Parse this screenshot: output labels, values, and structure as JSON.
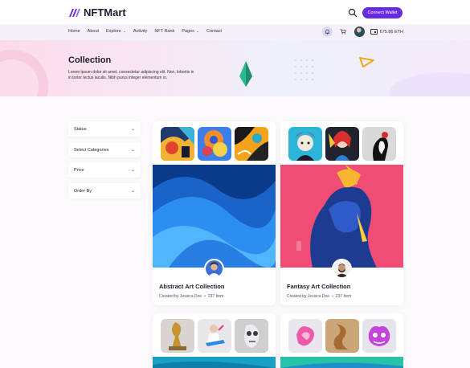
{
  "brand": {
    "name": "NFTMart",
    "accent": "#6a2ae0"
  },
  "header": {
    "connect_label": "Connect Wallet",
    "search_icon": "search-icon"
  },
  "nav": {
    "items": [
      {
        "label": "Home",
        "dropdown": false
      },
      {
        "label": "About",
        "dropdown": false
      },
      {
        "label": "Explore",
        "dropdown": true
      },
      {
        "label": "Activity",
        "dropdown": false
      },
      {
        "label": "NFT Rank",
        "dropdown": false
      },
      {
        "label": "Pages",
        "dropdown": true
      },
      {
        "label": "Contact",
        "dropdown": false
      }
    ],
    "balance": "675.86 ETH"
  },
  "hero": {
    "title": "Collection",
    "description": "Lorem ipsum dolor sit amet, consectetur adipiscing elit. Non, lobortis in in tortor lectus iaculis. Nibh purus integer elementum in."
  },
  "filters": [
    {
      "label": "Status"
    },
    {
      "label": "Select Categories"
    },
    {
      "label": "Price"
    },
    {
      "label": "Order By"
    }
  ],
  "collections": [
    {
      "title": "Abstract Art Collection",
      "creator": "Created by Jessica Doe",
      "separator": "•",
      "items": "237 Item"
    },
    {
      "title": "Fantasy Art Collection",
      "creator": "Created by Jessica Doe",
      "separator": "•",
      "items": "237 Item"
    },
    {
      "title": "",
      "creator": "",
      "separator": "",
      "items": ""
    },
    {
      "title": "",
      "creator": "",
      "separator": "",
      "items": ""
    }
  ]
}
